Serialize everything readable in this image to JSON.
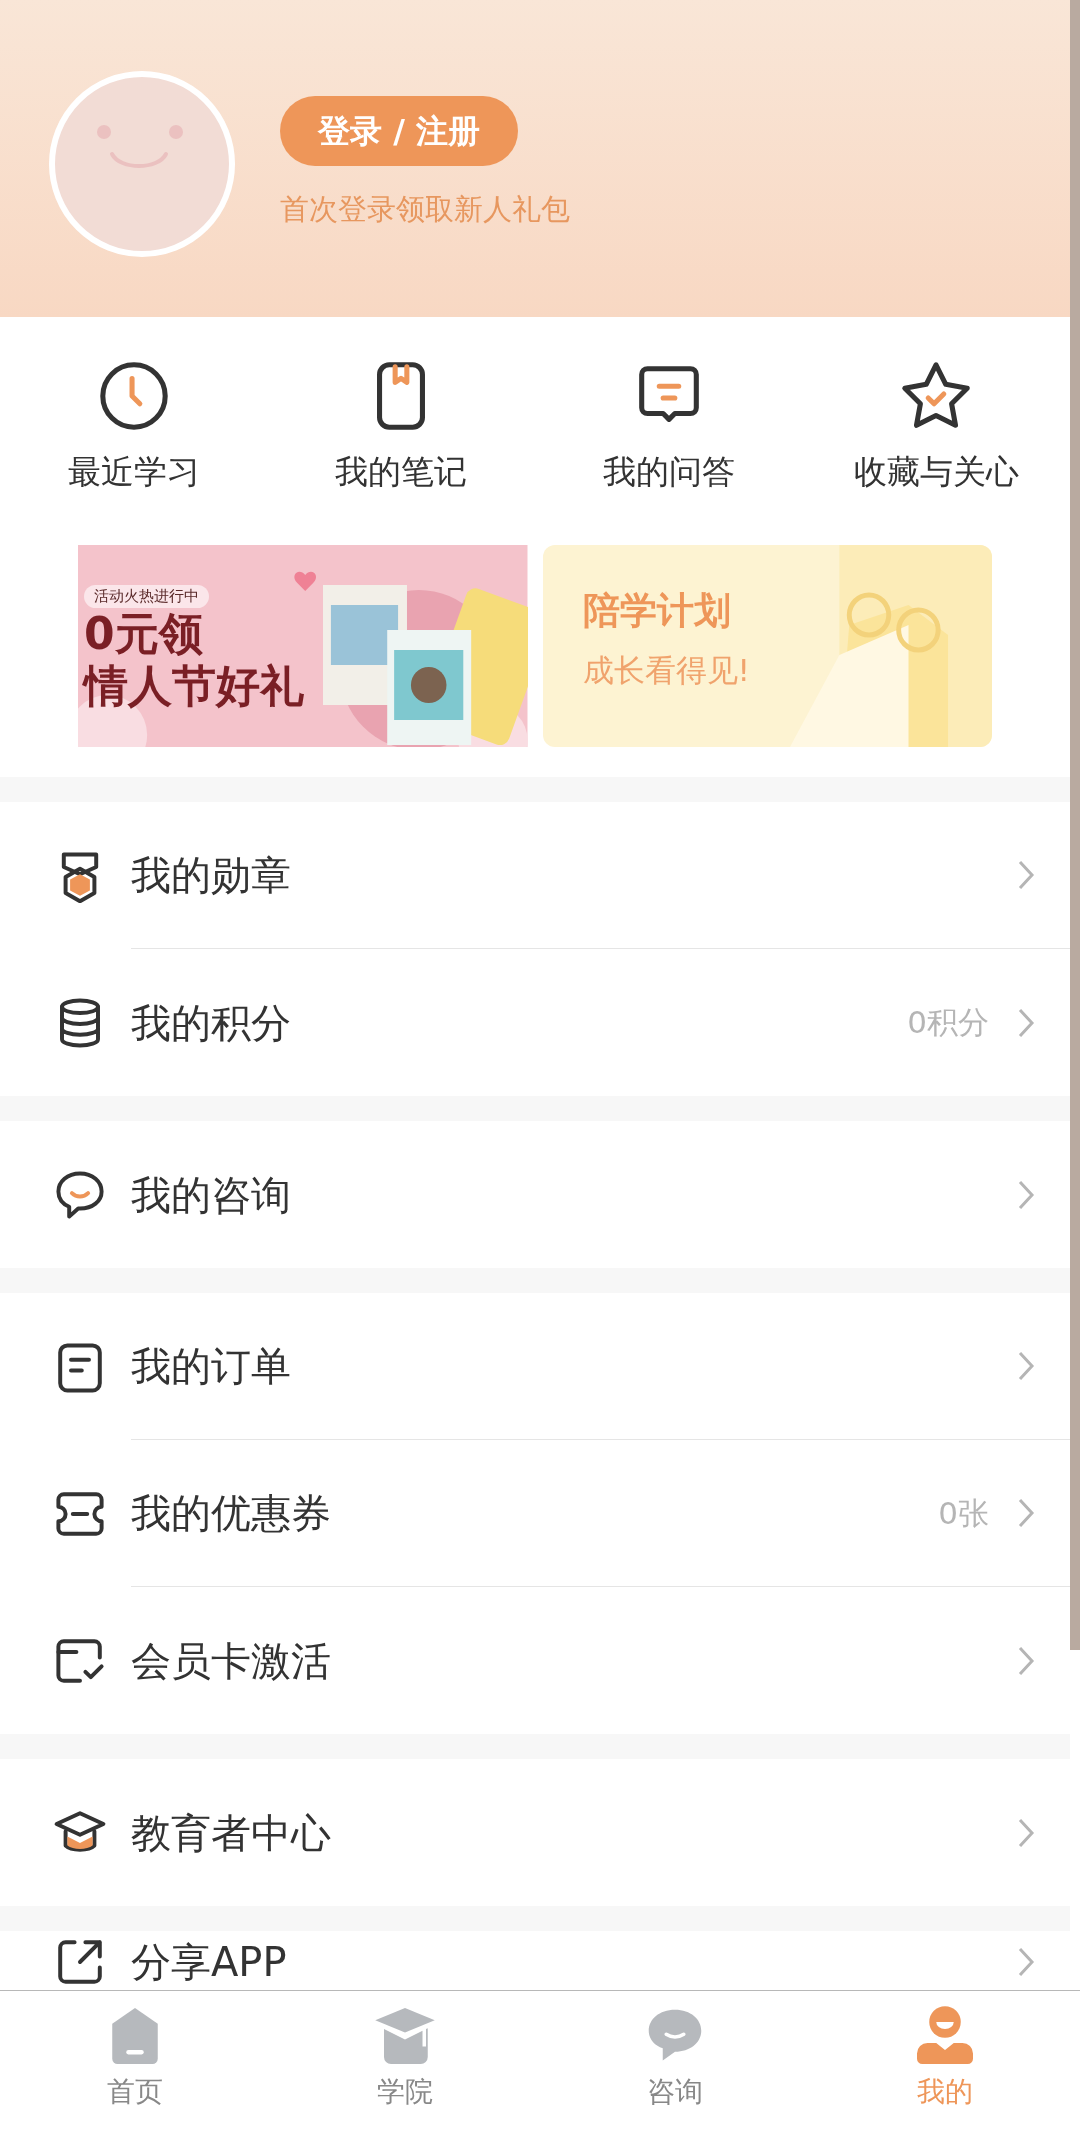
{
  "profile": {
    "login_button": "登录 / 注册",
    "hint": "首次登录领取新人礼包"
  },
  "shortcuts": [
    {
      "kind": "clock",
      "label": "最近学习"
    },
    {
      "kind": "bookmark",
      "label": "我的笔记"
    },
    {
      "kind": "message",
      "label": "我的问答"
    },
    {
      "kind": "star",
      "label": "收藏与关心"
    }
  ],
  "banners": [
    {
      "kind": "promo",
      "tag": "活动火热进行中",
      "title_lines": [
        "0元领",
        "情人节好礼"
      ]
    },
    {
      "kind": "plan",
      "title": "陪学计划",
      "subtitle": "成长看得见!"
    }
  ],
  "menu_groups": [
    [
      {
        "kind": "medal",
        "label": "我的勋章"
      },
      {
        "kind": "coins",
        "label": "我的积分",
        "value": "0积分"
      }
    ],
    [
      {
        "kind": "chat",
        "label": "我的咨询"
      }
    ],
    [
      {
        "kind": "order",
        "label": "我的订单"
      },
      {
        "kind": "coupon",
        "label": "我的优惠券",
        "value": "0张"
      },
      {
        "kind": "card",
        "label": "会员卡激活"
      }
    ],
    [
      {
        "kind": "cap",
        "label": "教育者中心"
      }
    ],
    [
      {
        "kind": "share",
        "label": "分享APP"
      }
    ]
  ],
  "tab_bar": [
    {
      "kind": "home",
      "label": "首页",
      "selected": false
    },
    {
      "kind": "cap",
      "label": "学院",
      "selected": false
    },
    {
      "kind": "chat",
      "label": "咨询",
      "selected": false
    },
    {
      "kind": "person",
      "label": "我的",
      "selected": true
    }
  ]
}
